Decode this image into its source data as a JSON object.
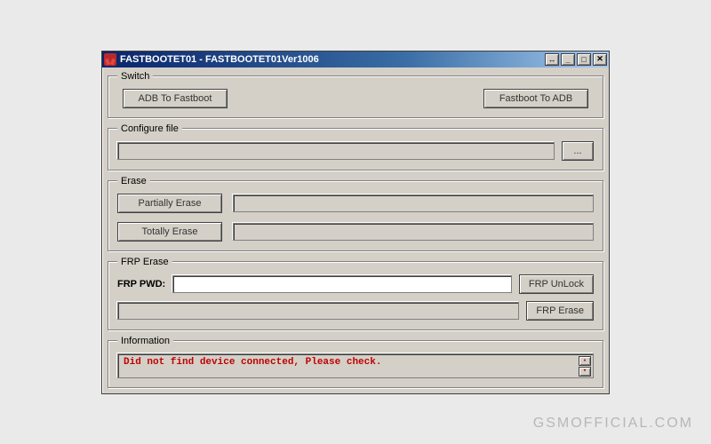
{
  "window": {
    "title": "FASTBOOTET01 - FASTBOOTET01Ver1006"
  },
  "switch": {
    "legend": "Switch",
    "adb_to_fastboot": "ADB To Fastboot",
    "fastboot_to_adb": "Fastboot To ADB"
  },
  "configure": {
    "legend": "Configure file",
    "path": "",
    "browse": "..."
  },
  "erase": {
    "legend": "Erase",
    "partially": "Partially Erase",
    "totally": "Totally Erase",
    "status_partial": "",
    "status_total": ""
  },
  "frp": {
    "legend": "FRP Erase",
    "pwd_label": "FRP PWD:",
    "pwd_value": "",
    "unlock": "FRP UnLock",
    "erase": "FRP Erase",
    "status": ""
  },
  "info": {
    "legend": "Information",
    "message": "Did not find device connected, Please check."
  },
  "watermark": "GSMOFFICIAL.COM",
  "icons": {
    "resize": "↔",
    "minimize": "_",
    "maximize": "□",
    "close": "✕",
    "up": "▴",
    "down": "▾"
  }
}
